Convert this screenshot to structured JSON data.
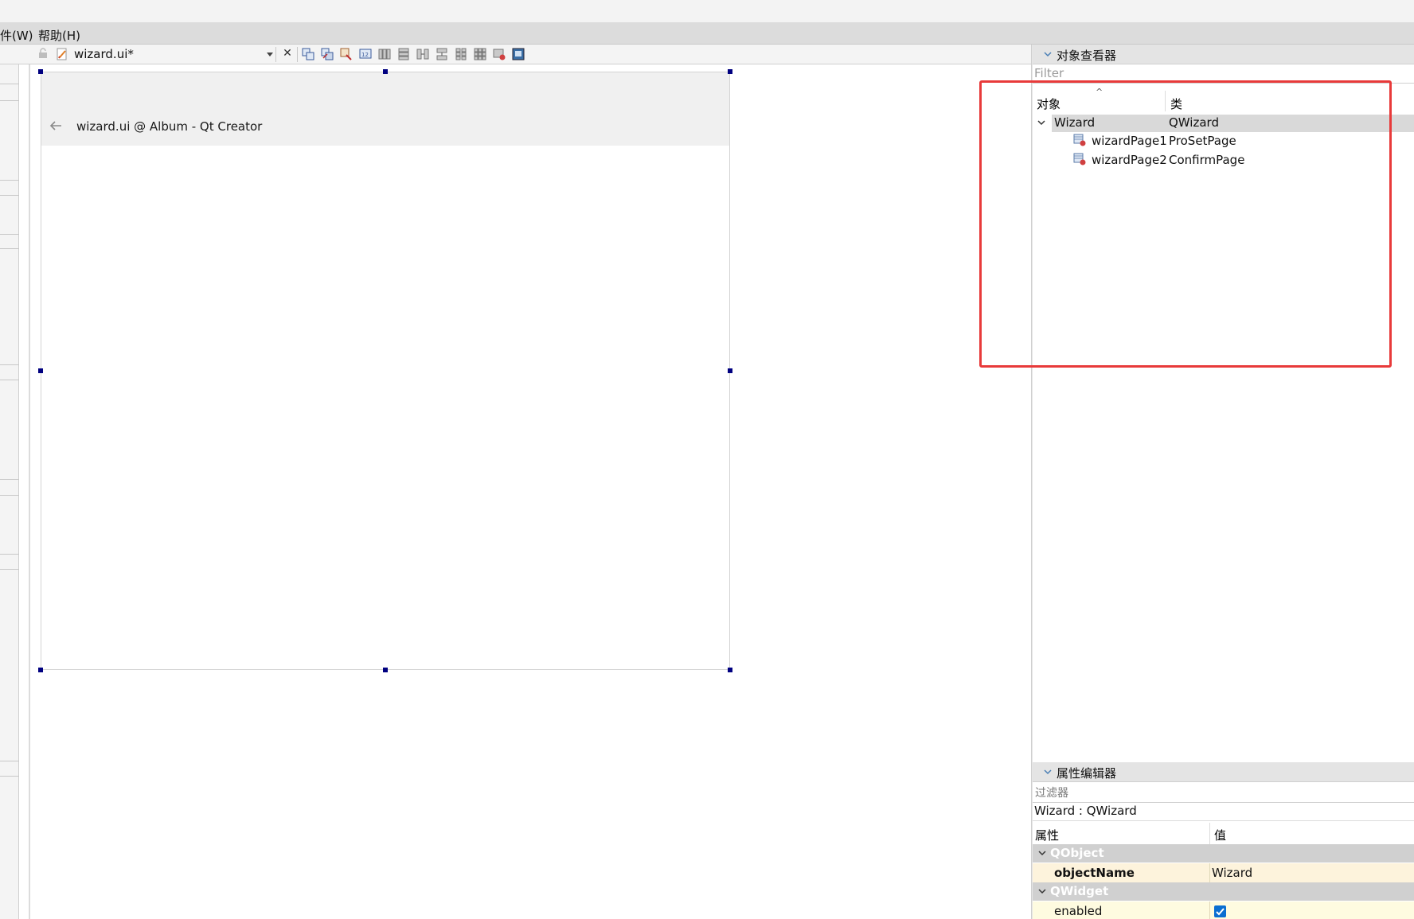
{
  "menubar": {
    "items": [
      {
        "label": "件(W)"
      },
      {
        "label": "帮助(H)"
      }
    ]
  },
  "toolbar": {
    "file_title": "wizard.ui*",
    "icons": [
      "lock-icon",
      "form-edit-icon",
      "dropdown-arrow-icon",
      "close-icon",
      "edit-widgets-icon",
      "edit-signals-icon",
      "edit-buddies-icon",
      "edit-tab-order-icon",
      "layout-horizontal-icon",
      "layout-vertical-icon",
      "layout-splitter-h-icon",
      "layout-splitter-v-icon",
      "layout-form-icon",
      "layout-grid-icon",
      "break-layout-icon",
      "adjust-size-icon"
    ]
  },
  "form": {
    "window_title": "wizard.ui @ Album - Qt Creator"
  },
  "object_inspector": {
    "title": "对象查看器",
    "filter_placeholder": "Filter",
    "columns": {
      "object": "对象",
      "class": "类"
    },
    "rows": [
      {
        "object": "Wizard",
        "class": "QWizard",
        "expanded": true
      },
      {
        "object": "wizardPage1",
        "class": "ProSetPage"
      },
      {
        "object": "wizardPage2",
        "class": "ConfirmPage"
      }
    ]
  },
  "property_editor": {
    "title": "属性编辑器",
    "filter_placeholder": "过滤器",
    "context": "Wizard : QWizard",
    "columns": {
      "property": "属性",
      "value": "值"
    },
    "groups": [
      {
        "name": "QObject",
        "props": [
          {
            "name": "objectName",
            "value": "Wizard"
          }
        ]
      },
      {
        "name": "QWidget",
        "props": [
          {
            "name": "enabled",
            "value": true
          }
        ]
      }
    ]
  },
  "colors": {
    "highlight_box": "#e83a3a",
    "selection_handle": "#000080",
    "property_row_bg": "#fdf3dc",
    "group_bg": "#d0d0d0",
    "checkbox": "#0a6ed1"
  }
}
